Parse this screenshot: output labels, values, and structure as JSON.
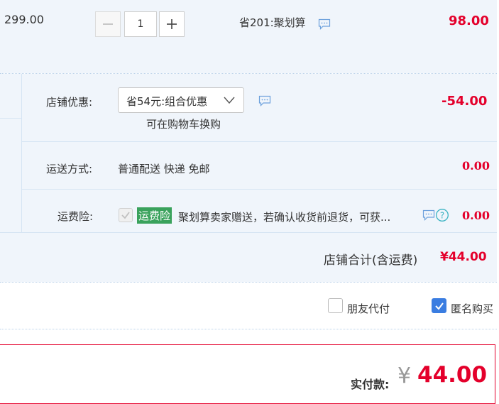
{
  "item": {
    "unit_price": "299.00",
    "quantity": "1",
    "promo": "省201:聚划算",
    "subtotal": "98.00"
  },
  "shop_discount": {
    "label": "店铺优惠:",
    "selected": "省54元:组合优惠",
    "hint": "可在购物车换购",
    "amount": "-54.00"
  },
  "shipping": {
    "label": "运送方式:",
    "method": "普通配送 快递 免邮",
    "amount": "0.00"
  },
  "insurance": {
    "label": "运费险:",
    "tag": "运费险",
    "desc": "聚划算卖家赠送，若确认收货前退货，可获...",
    "amount": "0.00"
  },
  "shop_total": {
    "label": "店铺合计(含运费)",
    "amount": "¥44.00"
  },
  "options": {
    "friend_pay": "朋友代付",
    "anonymous": "匿名购买",
    "anonymous_checked": true,
    "friend_pay_checked": false
  },
  "payment": {
    "label": "实付款:",
    "currency": "¥",
    "amount": "44.00"
  },
  "colors": {
    "price_red": "#e4002b",
    "tag_green": "#3aa25c",
    "checkbox_blue": "#3a7de1",
    "row_bg": "#f0f5fb"
  },
  "icons": [
    "minus-icon",
    "plus-icon",
    "chat-icon",
    "chevron-down-icon",
    "help-icon",
    "check-icon"
  ]
}
